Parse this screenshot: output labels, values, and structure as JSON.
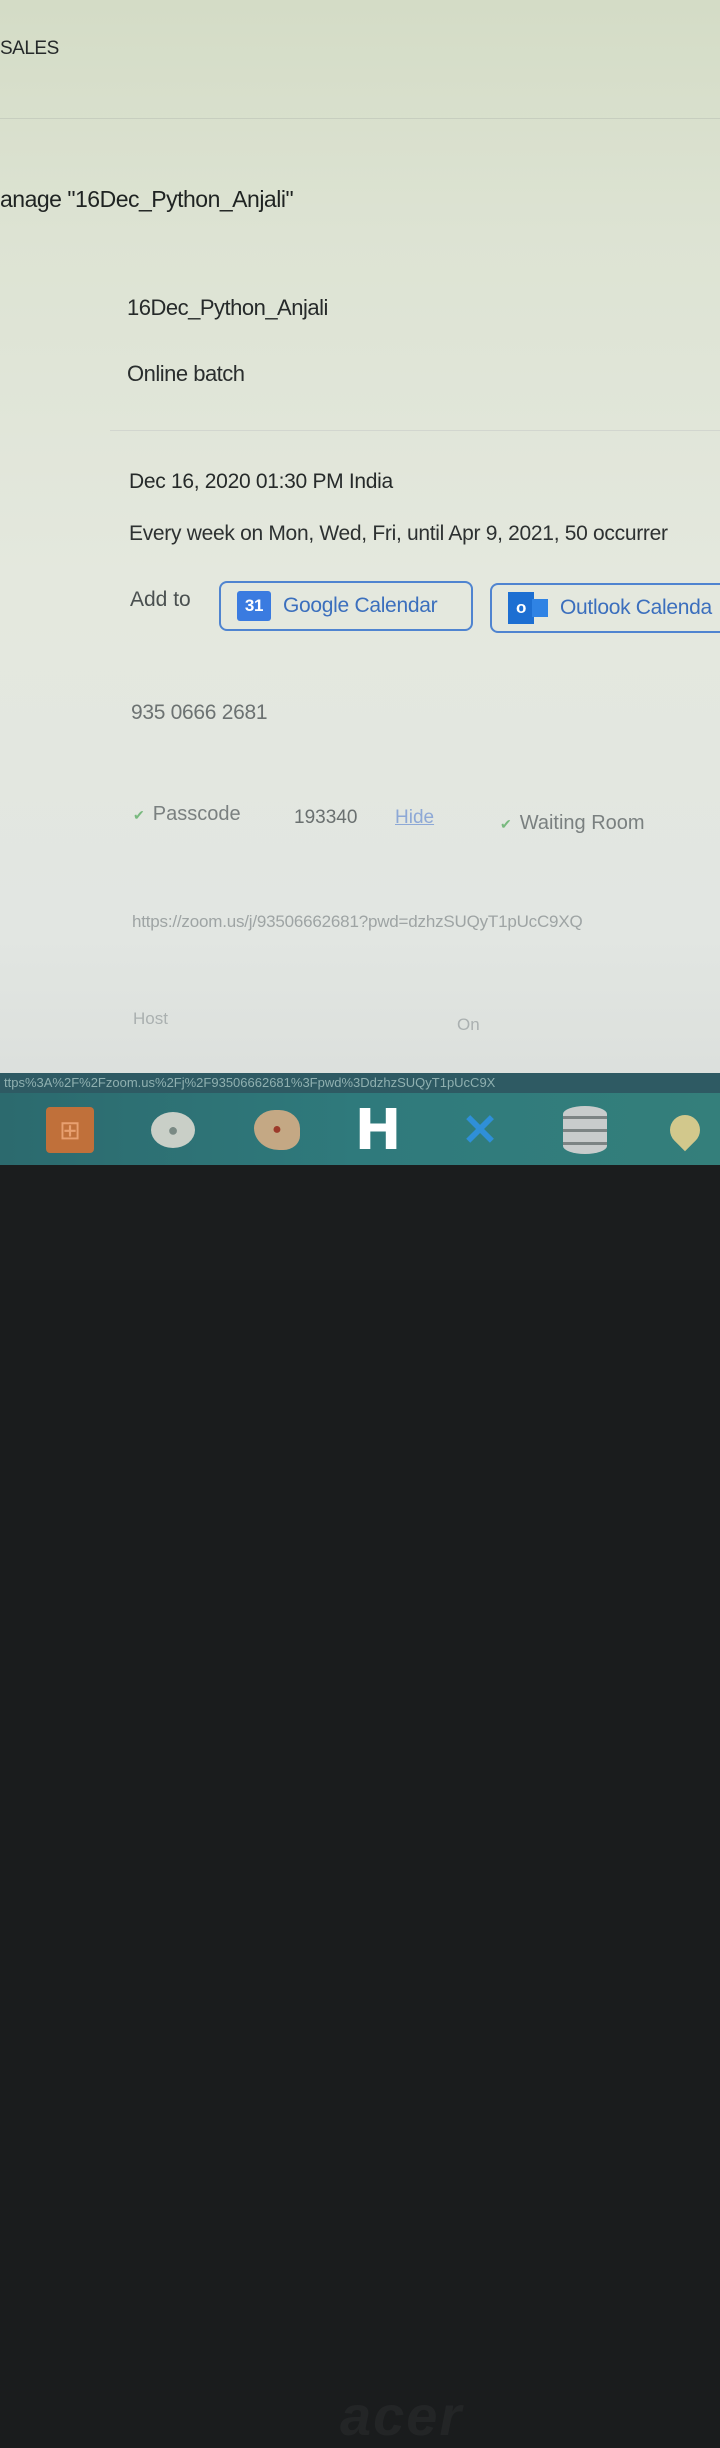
{
  "header": {
    "brand": "SALES"
  },
  "page": {
    "title": "anage \"16Dec_Python_Anjali\""
  },
  "meeting": {
    "topic": "16Dec_Python_Anjali",
    "description": "Online batch",
    "time": "Dec 16, 2020 01:30 PM India",
    "recurrence": "Every week on Mon, Wed, Fri, until Apr 9, 2021, 50 occurrer",
    "add_to_label": "Add to",
    "google_calendar": {
      "icon": "calendar-icon",
      "icon_text": "31",
      "label": "Google Calendar",
      "color": "#3a7be0"
    },
    "outlook_calendar": {
      "icon": "outlook-icon",
      "icon_text": "o",
      "label": "Outlook Calenda",
      "color": "#1d6fd2"
    },
    "meeting_id": "935 0666 2681",
    "passcode_label": "Passcode",
    "passcode_value": "193340",
    "hide_label": "Hide",
    "waiting_room_label": "Waiting Room",
    "invite_link": "https://zoom.us/j/93506662681?pwd=dzhzSUQyT1pUcC9XQ",
    "host_label": "Host",
    "host_value": "On"
  },
  "statusbar": {
    "url": "ttps%3A%2F%2Fzoom.us%2Fj%2F93506662681%3Fpwd%3DdzhzSUQyT1pUcC9X"
  },
  "taskbar": {
    "apps": [
      "xampp-icon",
      "chat-icon",
      "paint-icon",
      "h-app-icon",
      "vscode-icon",
      "database-icon",
      "maps-icon"
    ],
    "h_app_glyph": "H"
  },
  "bezel": {
    "logo": "acer"
  }
}
